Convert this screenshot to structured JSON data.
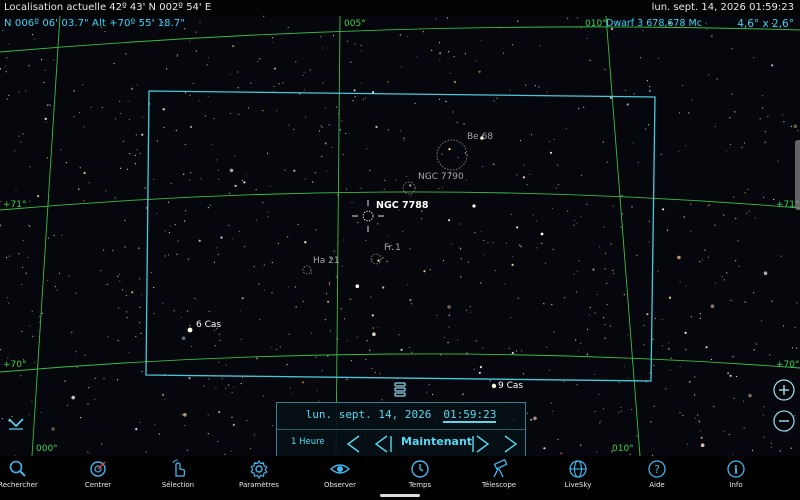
{
  "status": {
    "location": "Localisation actuelle  42º 43' N  002º 54' E",
    "datetime": "lun. sept. 14, 2026  01:59:23"
  },
  "readouts": {
    "coords": "N  006º 06' 03.7\"  Alt +70º 55' 18.7\"",
    "device": "Dwarf 3  678,678 Mc",
    "fov": "4,6° x 2,6°"
  },
  "grid": {
    "ra_005": "005°",
    "ra_010_top": "010°",
    "ra_010_bottom": "010°",
    "ra_000": "000°",
    "dec_71_left": "+71°",
    "dec_71_right": "+71°",
    "dec_70_left": "+70°",
    "dec_70_right": "+70°"
  },
  "objects": {
    "be68": "Be 68",
    "ngc7790": "NGC 7790",
    "ngc7788": "NGC 7788",
    "fr1": "Fr 1",
    "ha21": "Ha 21",
    "cas6": "6 Cas",
    "cas9": "9 Cas"
  },
  "time_panel": {
    "date": "lun. sept. 14, 2026",
    "time": "01:59:23",
    "step": "1 Heure",
    "now": "Maintenant"
  },
  "toolbar": {
    "items": [
      {
        "label": "Rechercher",
        "icon": "search-icon"
      },
      {
        "label": "Centrer",
        "icon": "center-icon"
      },
      {
        "label": "Sélection",
        "icon": "select-icon"
      },
      {
        "label": "Paramètres",
        "icon": "gear-icon"
      },
      {
        "label": "Observer",
        "icon": "eye-icon"
      },
      {
        "label": "Temps",
        "icon": "clock-icon"
      },
      {
        "label": "Télescope",
        "icon": "telescope-icon"
      },
      {
        "label": "LiveSky",
        "icon": "globe-icon"
      },
      {
        "label": "Aide",
        "icon": "help-icon"
      },
      {
        "label": "Info",
        "icon": "info-icon"
      }
    ]
  },
  "colors": {
    "accent": "#56d8f2",
    "grid": "#3ed24e",
    "fov_frame": "#49c8dd",
    "background": "#05070c"
  }
}
